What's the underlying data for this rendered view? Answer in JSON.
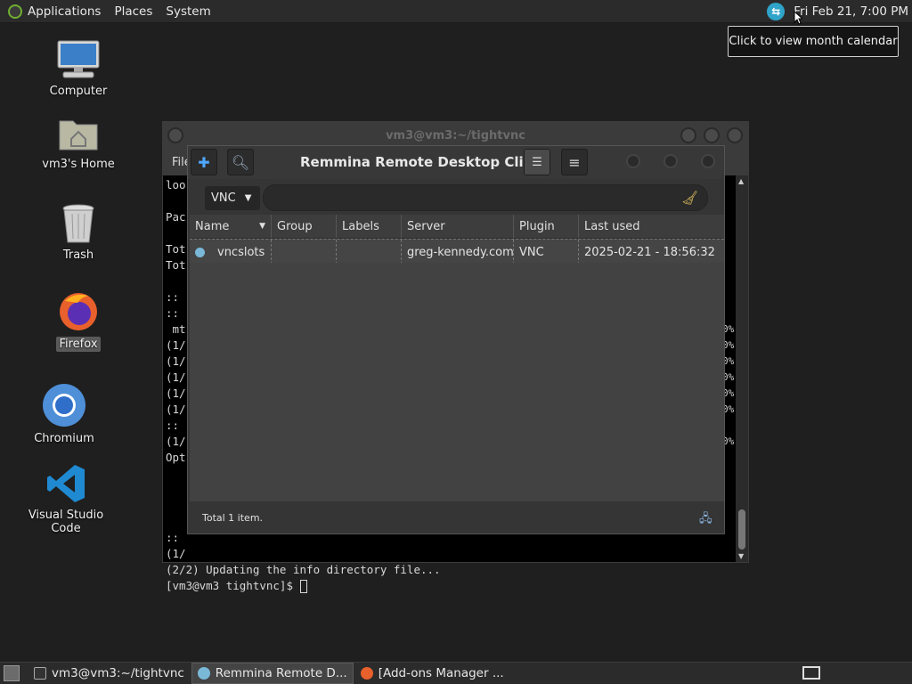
{
  "top_panel": {
    "menus": [
      "Applications",
      "Places",
      "System"
    ],
    "clock": "Fri Feb 21,  7:00 PM",
    "tooltip": "Click to view month calendar"
  },
  "desktop_icons": [
    {
      "label": "Computer"
    },
    {
      "label": "vm3's Home"
    },
    {
      "label": "Trash"
    },
    {
      "label": "Firefox"
    },
    {
      "label": "Chromium"
    },
    {
      "label": "Visual Studio Code"
    }
  ],
  "terminal": {
    "title": "vm3@vm3:~/tightvnc",
    "menu_visible": "File",
    "lines": [
      "loo",
      "",
      "Pac",
      "",
      "Tot",
      "Tot",
      "",
      "::",
      "::",
      " mt",
      "(1/",
      "(1/",
      "(1/",
      "(1/",
      "(1/",
      "::",
      "(1/",
      "Opt",
      "",
      "",
      "",
      "",
      "::",
      "(1/",
      "(2/2) Updating the info directory file..."
    ],
    "prompt": "[vm3@vm3 tightvnc]$ ",
    "right_lines": [
      "",
      "",
      "",
      "",
      "",
      "",
      "",
      "",
      "",
      "0%",
      "0%",
      "0%",
      "0%",
      "0%",
      "0%",
      "",
      "0%"
    ]
  },
  "remmina": {
    "title": "Remmina Remote Desktop Client",
    "protocol": "VNC",
    "search_placeholder": "",
    "columns": [
      "Name",
      "Group",
      "Labels",
      "Server",
      "Plugin",
      "Last used"
    ],
    "rows": [
      {
        "name": "vncslots",
        "group": "",
        "labels": "",
        "server": "greg-kennedy.com",
        "plugin": "VNC",
        "last_used": "2025-02-21 - 18:56:32"
      }
    ],
    "status": "Total 1 item."
  },
  "taskbar": {
    "tasks": [
      "vm3@vm3:~/tightvnc",
      "Remmina Remote D...",
      "[Add-ons Manager ..."
    ]
  }
}
